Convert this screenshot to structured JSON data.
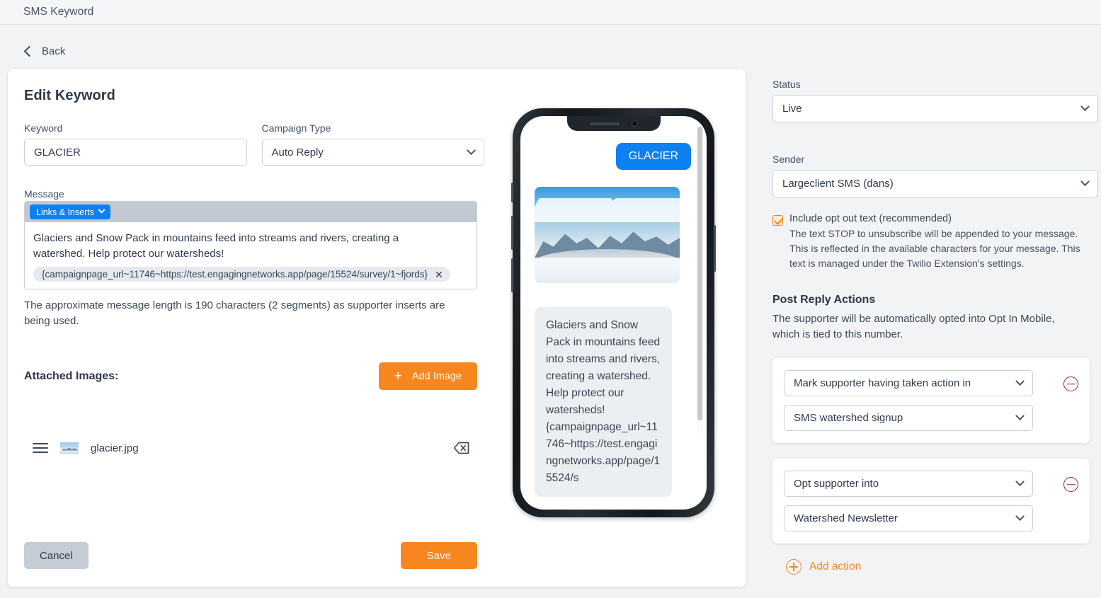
{
  "topbar": {
    "title": "SMS Keyword"
  },
  "nav": {
    "back_label": "Back",
    "back_icon": "chevron-left-icon"
  },
  "form": {
    "heading": "Edit Keyword",
    "keyword": {
      "label": "Keyword",
      "value": "GLACIER",
      "placeholder": ""
    },
    "campaign_type": {
      "label": "Campaign Type",
      "value": "Auto Reply",
      "options": [
        "Auto Reply"
      ]
    },
    "message": {
      "label": "Message",
      "toolbar_button": "Links & Inserts",
      "body": "Glaciers and Snow Pack in mountains feed into streams and rivers, creating a watershed. Help protect our watersheds!",
      "insert_chip": "{campaignpage_url~11746~https://test.engagingnetworks.app/page/15524/survey/1~fjords}",
      "chip_remove_icon": "✕",
      "note": "The approximate message length is 190 characters (2 segments) as supporter inserts are being used."
    },
    "attached_images": {
      "title": "Attached Images:",
      "add_button": "Add Image",
      "files": [
        {
          "name": "glacier.jpg"
        }
      ]
    },
    "buttons": {
      "cancel": "Cancel",
      "save": "Save"
    }
  },
  "preview": {
    "outgoing_bubble": "GLACIER",
    "incoming_bubble": "Glaciers and Snow Pack in mountains feed into streams and rivers, creating a watershed. Help protect our watersheds! {campaignpage_url~11746~https://test.engagingnetworks.app/page/15524/s"
  },
  "sidebar": {
    "status": {
      "label": "Status",
      "value": "Live"
    },
    "sender": {
      "label": "Sender",
      "value": "Largeclient SMS (dans)"
    },
    "opt_out": {
      "title": "Include opt out text (recommended)",
      "description": "The text STOP to unsubscribe will be appended to your message. This is reflected in the available characters for your message. This text is managed under the Twilio Extension's settings.",
      "checked": true
    },
    "post_reply_actions": {
      "title": "Post Reply Actions",
      "description": "The supporter will be automatically opted into Opt In Mobile, which is tied to this number.",
      "actions": [
        {
          "type": "Mark supporter having taken action in",
          "target": "SMS watershed signup"
        },
        {
          "type": "Opt supporter into",
          "target": "Watershed Newsletter"
        }
      ],
      "add_action_label": "Add action"
    }
  },
  "colors": {
    "accent_orange": "#f7861f",
    "primary_blue": "#0d80f2",
    "danger_red": "#9b2131",
    "page_bg": "#f2f3f4"
  }
}
